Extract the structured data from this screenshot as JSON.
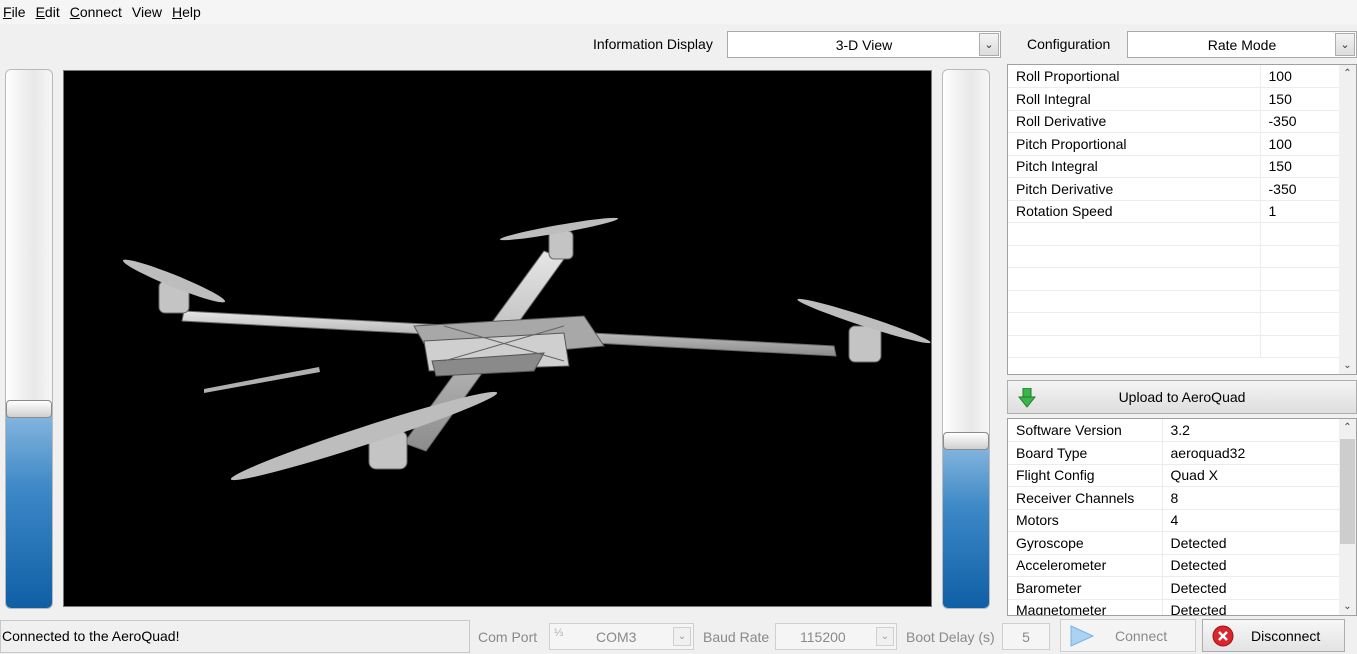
{
  "menu": [
    {
      "label": "File",
      "mnemonic": "F",
      "rest": "ile"
    },
    {
      "label": "Edit",
      "mnemonic": "E",
      "rest": "dit"
    },
    {
      "label": "Connect",
      "mnemonic": "C",
      "rest": "onnect"
    },
    {
      "label": "View",
      "mnemonic": "",
      "rest": "View"
    },
    {
      "label": "Help",
      "mnemonic": "H",
      "rest": "elp"
    }
  ],
  "info_display": {
    "label": "Information Display",
    "selected": "3-D View"
  },
  "configuration": {
    "label": "Configuration",
    "selected": "Rate Mode"
  },
  "config_rows": [
    {
      "name": "Roll Proportional",
      "value": "100"
    },
    {
      "name": "Roll Integral",
      "value": "150"
    },
    {
      "name": "Roll Derivative",
      "value": "-350"
    },
    {
      "name": "Pitch Proportional",
      "value": "100"
    },
    {
      "name": "Pitch Integral",
      "value": "150"
    },
    {
      "name": "Pitch Derivative",
      "value": "-350"
    },
    {
      "name": "Rotation Speed",
      "value": "1"
    }
  ],
  "upload_label": "Upload to AeroQuad",
  "info_rows": [
    {
      "name": "Software Version",
      "value": "3.2"
    },
    {
      "name": "Board Type",
      "value": "aeroquad32"
    },
    {
      "name": "Flight Config",
      "value": "Quad X"
    },
    {
      "name": "Receiver Channels",
      "value": "8"
    },
    {
      "name": "Motors",
      "value": "4"
    },
    {
      "name": "Gyroscope",
      "value": "Detected"
    },
    {
      "name": "Accelerometer",
      "value": "Detected"
    },
    {
      "name": "Barometer",
      "value": "Detected"
    },
    {
      "name": "Magnetometer",
      "value": "Detected"
    }
  ],
  "status": "Connected to the AeroQuad!",
  "com_port": {
    "label": "Com Port",
    "value": "COM3"
  },
  "baud_rate": {
    "label": "Baud Rate",
    "value": "115200"
  },
  "boot_delay": {
    "label": "Boot Delay (s)",
    "value": "5"
  },
  "connect_label": "Connect",
  "disconnect_label": "Disconnect",
  "sliders": {
    "left_level": 0.37,
    "right_level": 0.31
  },
  "colors": {
    "slider_fill": "#1a6bb3",
    "view_bg": "#000000",
    "disconnect_red": "#d9262c",
    "upload_green": "#3bb54a"
  }
}
